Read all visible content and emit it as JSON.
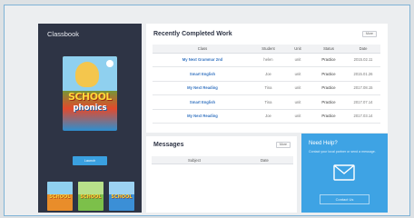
{
  "classbook": {
    "title": "Classbook",
    "launch_label": "Launch",
    "main_book": {
      "line1": "SCHOOL",
      "line2": "phonics"
    },
    "thumbnails": [
      {
        "label": "SCHOOL",
        "color": "#e98d2a"
      },
      {
        "label": "SCHOOL",
        "color": "#7cc04a"
      },
      {
        "label": "SCHOOL",
        "color": "#3b8fd6"
      }
    ],
    "pages": 5,
    "active_page": 0
  },
  "recent_work": {
    "title": "Recently Completed Work",
    "more_label": "More",
    "columns": [
      "Class",
      "Student",
      "Unit",
      "Status",
      "Date"
    ],
    "rows": [
      {
        "class": "My Next Grammar 2nd",
        "student": "helen",
        "unit": "unit",
        "status": "Practice",
        "date": "2015.02.11"
      },
      {
        "class": "Smart English",
        "student": "Joe",
        "unit": "unit",
        "status": "Practice",
        "date": "2015.01.26"
      },
      {
        "class": "My Next Reading",
        "student": "Tina",
        "unit": "unit",
        "status": "Practice",
        "date": "2017.08.15"
      },
      {
        "class": "Smart English",
        "student": "Tina",
        "unit": "unit",
        "status": "Practice",
        "date": "2017.07.14"
      },
      {
        "class": "My Next Reading",
        "student": "Joe",
        "unit": "unit",
        "status": "Practice",
        "date": "2017.03.14"
      }
    ]
  },
  "messages": {
    "title": "Messages",
    "more_label": "More",
    "columns": [
      "Subject",
      "Date"
    ]
  },
  "help": {
    "title": "Need Help?",
    "description": "Contact your local partner or send a message.",
    "contact_label": "Contact Us"
  },
  "colors": {
    "accent": "#3aa0e0",
    "panel_dark": "#2e3445",
    "link": "#3a77c2"
  }
}
